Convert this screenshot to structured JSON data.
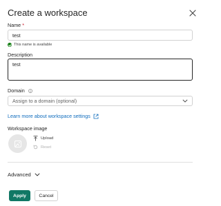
{
  "dialog": {
    "title": "Create a workspace"
  },
  "name": {
    "label": "Name",
    "required_mark": "*",
    "value": "test",
    "helper": "This name is available"
  },
  "description": {
    "label": "Description",
    "value": "test"
  },
  "domain": {
    "label": "Domain",
    "placeholder": "Assign to a domain (optional)"
  },
  "learn_more": {
    "label": "Learn more about workspace settings"
  },
  "workspace_image": {
    "label": "Workspace image",
    "upload_label": "Upload",
    "reset_label": "Reset"
  },
  "advanced": {
    "label": "Advanced"
  },
  "footer": {
    "apply_label": "Apply",
    "cancel_label": "Cancel"
  },
  "colors": {
    "accent": "#117865",
    "link": "#0f6cbd",
    "success": "#107c10",
    "required": "#c50f1f"
  },
  "icons": {
    "close": "close-icon",
    "success": "checkmark-circle-icon",
    "info": "info-icon",
    "chevron": "chevron-down-icon",
    "external": "open-external-icon",
    "image": "image-placeholder-icon",
    "upload": "upload-icon",
    "reset": "reset-icon"
  }
}
